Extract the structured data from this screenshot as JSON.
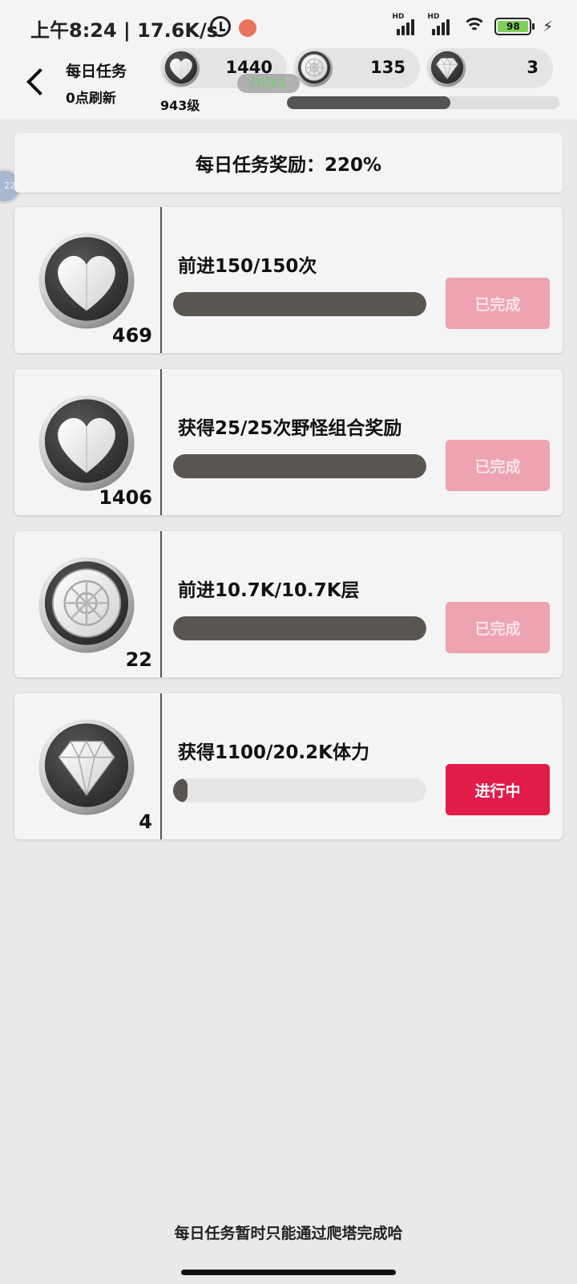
{
  "status_bar": {
    "time": "上午8:24 | 17.6K/s",
    "signal_label": "HD",
    "battery": "98"
  },
  "header": {
    "title": "每日任务",
    "subtitle": "0点刷新",
    "level": "943级",
    "fps": "FPS61",
    "currencies": [
      {
        "icon": "heart-icon",
        "value": "1440"
      },
      {
        "icon": "coin-icon",
        "value": "135"
      },
      {
        "icon": "diamond-icon",
        "value": "3"
      }
    ],
    "exp_progress": 0.6
  },
  "side_bubble": "22",
  "banner": "每日任务奖励：220%",
  "tasks": [
    {
      "icon": "heart-icon",
      "count": "469",
      "name": "前进150/150次",
      "progress": 1.0,
      "button": "已完成",
      "state": "done"
    },
    {
      "icon": "heart-icon",
      "count": "1406",
      "name": "获得25/25次野怪组合奖励",
      "progress": 1.0,
      "button": "已完成",
      "state": "done"
    },
    {
      "icon": "coin-icon",
      "count": "22",
      "name": "前进10.7K/10.7K层",
      "progress": 1.0,
      "button": "已完成",
      "state": "done"
    },
    {
      "icon": "diamond-icon",
      "count": "4",
      "name": "获得1100/20.2K体力",
      "progress": 0.054,
      "button": "进行中",
      "state": "active"
    }
  ],
  "footer_note": "每日任务暂时只能通过爬塔完成哈",
  "colors": {
    "done_button": "#eea3b0",
    "active_button": "#e11c48",
    "progress_fill": "#595550",
    "battery": "#7fd05a"
  }
}
